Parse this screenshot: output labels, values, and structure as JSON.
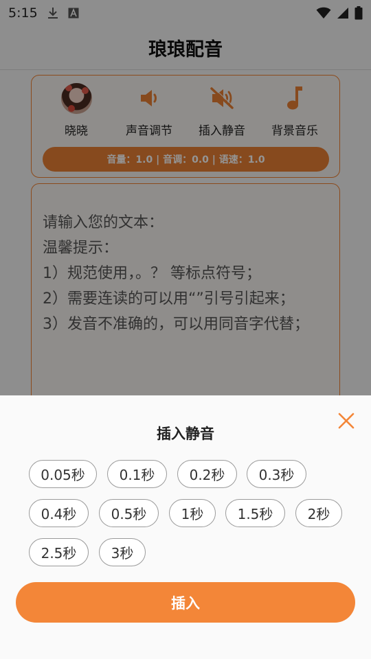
{
  "status_bar": {
    "time": "5:15",
    "left_icons": [
      "download-icon",
      "a-notification-icon"
    ],
    "right_icons": [
      "wifi-icon",
      "signal-icon",
      "battery-icon"
    ]
  },
  "header": {
    "title": "琅琅配音"
  },
  "voice_tools": {
    "items": [
      {
        "label": "晓晓",
        "icon": "avatar"
      },
      {
        "label": "声音调节",
        "icon": "speaker-icon"
      },
      {
        "label": "插入静音",
        "icon": "mute-icon"
      },
      {
        "label": "背景音乐",
        "icon": "music-note-icon"
      }
    ],
    "params": "音量：1.0 | 音调：0.0 | 语速：1.0"
  },
  "text_input": {
    "placeholder": "请输入您的文本：\n温馨提示：\n1）规范使用，。？ 等标点符号；\n2）需要连读的可以用“”引号引起来；\n3）发音不准确的，可以用同音字代替；"
  },
  "sheet": {
    "title": "插入静音",
    "options": [
      "0.05秒",
      "0.1秒",
      "0.2秒",
      "0.3秒",
      "0.4秒",
      "0.5秒",
      "1秒",
      "1.5秒",
      "2秒",
      "2.5秒",
      "3秒"
    ],
    "insert_label": "插入"
  },
  "colors": {
    "accent": "#f38638",
    "border_accent": "#f08030",
    "dim": "rgba(0,0,0,0.42)"
  }
}
